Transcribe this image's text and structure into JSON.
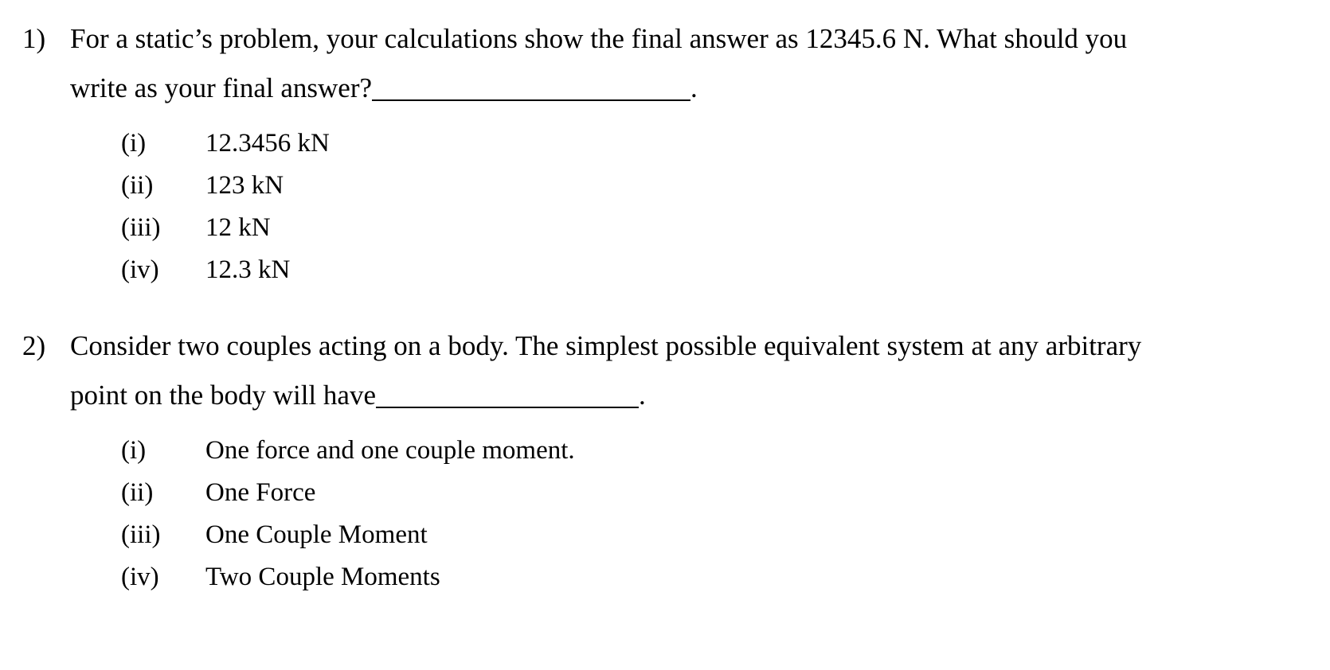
{
  "document": {
    "type": "quiz-questions",
    "background_color": "#ffffff",
    "text_color": "#000000"
  },
  "questions": [
    {
      "marker": "1)",
      "line1": "For a static’s problem, your calculations show the final answer as 12345.6 N. What should you",
      "line2_prefix": "write as your final answer?",
      "line2_suffix": ".",
      "blank": "",
      "options": [
        {
          "label": "(i)",
          "text": "12.3456 kN"
        },
        {
          "label": "(ii)",
          "text": "123 kN"
        },
        {
          "label": "(iii)",
          "text": "12 kN"
        },
        {
          "label": "(iv)",
          "text": "12.3 kN"
        }
      ]
    },
    {
      "marker": "2)",
      "line1": "Consider two couples acting on a body. The simplest possible equivalent system at any arbitrary",
      "line2_prefix": "point on the body will have",
      "line2_suffix": ".",
      "blank": "",
      "options": [
        {
          "label": "(i)",
          "text": "One force and one couple moment."
        },
        {
          "label": "(ii)",
          "text": "One Force"
        },
        {
          "label": "(iii)",
          "text": "One Couple Moment"
        },
        {
          "label": "(iv)",
          "text": "Two Couple Moments"
        }
      ]
    }
  ]
}
